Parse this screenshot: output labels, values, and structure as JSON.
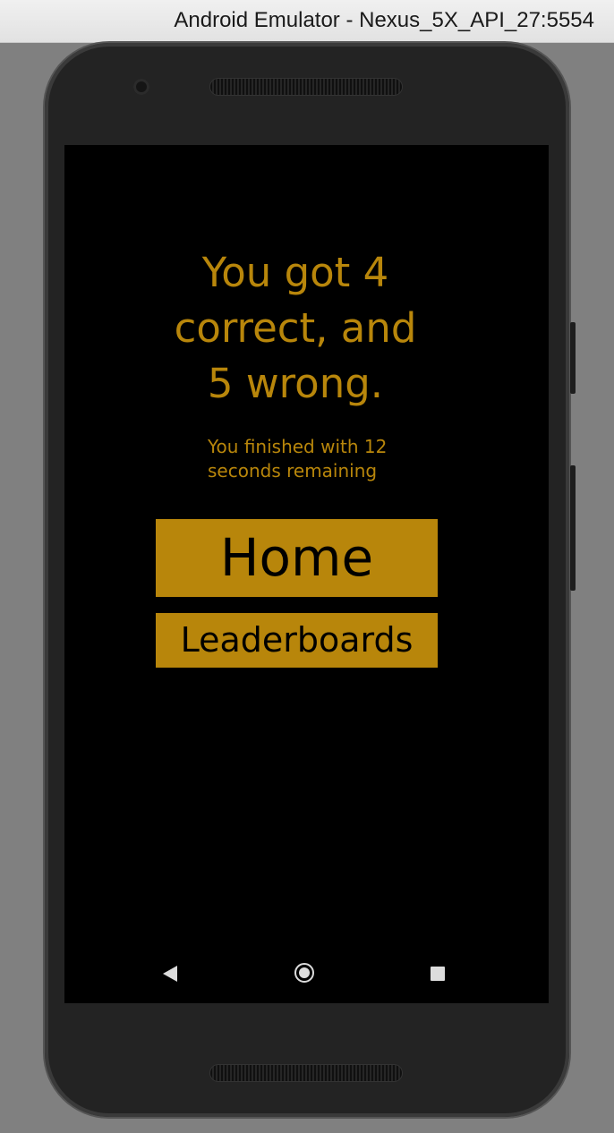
{
  "window": {
    "title": "Android Emulator - Nexus_5X_API_27:5554"
  },
  "app": {
    "result_heading": "You got 4\ncorrect, and\n5 wrong.",
    "time_message": "You finished with 12\nseconds remaining",
    "home_button_label": "Home",
    "leaderboards_button_label": "Leaderboards"
  },
  "colors": {
    "accent": "#b8860b",
    "screen_background": "#000000",
    "button_text": "#000000"
  },
  "icons": {
    "nav_back": "back-triangle-icon",
    "nav_home": "home-circle-icon",
    "nav_recents": "recents-square-icon"
  }
}
